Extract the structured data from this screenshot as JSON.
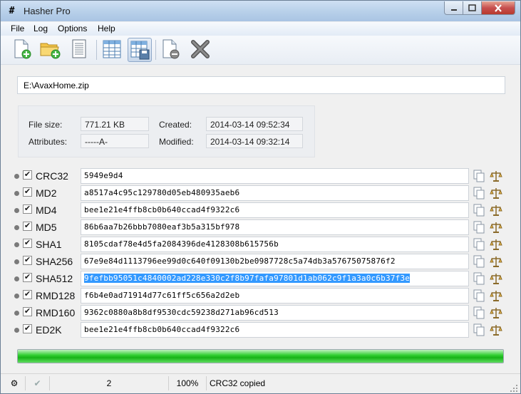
{
  "window": {
    "title": "Hasher Pro",
    "icon": "hash-glyph",
    "app_glyph": "#"
  },
  "menu": [
    "File",
    "Log",
    "Options",
    "Help"
  ],
  "toolbar": {
    "buttons": [
      {
        "icon": "new-file-icon",
        "name": "new-file-button"
      },
      {
        "icon": "open-folder-icon",
        "name": "open-folder-button"
      },
      {
        "icon": "document-icon",
        "name": "document-button"
      },
      {
        "icon": "table-icon",
        "name": "table-button"
      },
      {
        "icon": "table-save-icon",
        "name": "table-save-button",
        "pressed": true
      },
      {
        "icon": "remove-file-icon",
        "name": "remove-file-button"
      },
      {
        "icon": "close-x-icon",
        "name": "close-x-button"
      }
    ]
  },
  "file": {
    "path": "E:\\AvaxHome.zip",
    "size_label": "File size:",
    "size_value": "771.21 KB",
    "attributes_label": "Attributes:",
    "attributes_value": "-----A-",
    "created_label": "Created:",
    "created_value": "2014-03-14 09:52:34",
    "modified_label": "Modified:",
    "modified_value": "2014-03-14 09:32:14"
  },
  "hashes": [
    {
      "alg": "CRC32",
      "value": "5949e9d4",
      "checked": true
    },
    {
      "alg": "MD2",
      "value": "a8517a4c95c129780d05eb480935aeb6",
      "checked": true
    },
    {
      "alg": "MD4",
      "value": "bee1e21e4ffb8cb0b640ccad4f9322c6",
      "checked": true
    },
    {
      "alg": "MD5",
      "value": "86b6aa7b26bbb7080eaf3b5a315bf978",
      "checked": true
    },
    {
      "alg": "SHA1",
      "value": "8105cdaf78e4d5fa2084396de4128308b615756b",
      "checked": true
    },
    {
      "alg": "SHA256",
      "value": "67e9e84d1113796ee99d0c640f09130b2be0987728c5a74db3a57675075876f2",
      "checked": true
    },
    {
      "alg": "SHA512",
      "value": "9fefbb95051c4840002ad228e330c2f8b97fafa97801d1ab062c9f1a3a0c6b37f3e",
      "checked": true,
      "selected": true
    },
    {
      "alg": "RMD128",
      "value": "f6b4e0ad71914d77c61ff5c656a2d2eb",
      "checked": true
    },
    {
      "alg": "RMD160",
      "value": "9362c0880a8b8df9530cdc59238d271ab96cd513",
      "checked": true
    },
    {
      "alg": "ED2K",
      "value": "bee1e21e4ffb8cb0b640ccad4f9322c6",
      "checked": true
    }
  ],
  "progress": {
    "percent": 100
  },
  "status": {
    "count": "2",
    "percent": "100%",
    "message": "CRC32 copied",
    "check_glyph": "✔",
    "settings_glyph": "⚙"
  },
  "colors": {
    "selection": "#3399ff",
    "progress": "#22c022"
  }
}
